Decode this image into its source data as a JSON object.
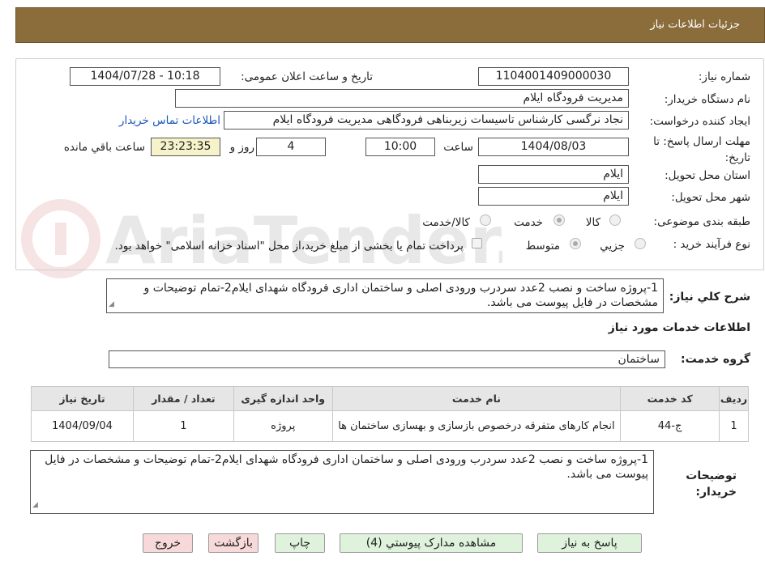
{
  "header": {
    "title": "جزئیات اطلاعات نیاز"
  },
  "form": {
    "need_number_label": "شماره نیاز:",
    "need_number": "1104001409000030",
    "announce_label": "تاریخ و ساعت اعلان عمومی:",
    "announce_value": "1404/07/28 - 10:18",
    "buyer_org_label": "نام دستگاه خریدار:",
    "buyer_org": "مدیریت فرودگاه ایلام",
    "requester_label": "ایجاد کننده درخواست:",
    "requester": "نجاد نرگسی کارشناس تاسیسات زیربناهی فرودگاهی مدیریت فرودگاه ایلام",
    "contact_link": "اطلاعات تماس خریدار",
    "deadline_label": "مهلت ارسال پاسخ: تا تاریخ:",
    "deadline_date": "1404/08/03",
    "time_label": "ساعت",
    "deadline_time": "10:00",
    "days_value": "4",
    "days_label": "روز و",
    "remaining_time": "23:23:35",
    "remaining_label": "ساعت باقي مانده",
    "province_label": "استان محل تحویل:",
    "province": "ایلام",
    "city_label": "شهر محل تحویل:",
    "city": "ایلام",
    "category_label": "طبقه بندی موضوعی:",
    "category_options": [
      "کالا",
      "خدمت",
      "کالا/خدمت"
    ],
    "category_selected": "خدمت",
    "process_label": "نوع فرآیند خرید :",
    "process_options": [
      "جزیي",
      "متوسط"
    ],
    "process_selected": "متوسط",
    "payment_note": "پرداخت تمام یا بخشی از مبلغ خرید،از محل \"اسناد خزانه اسلامی\" خواهد بود."
  },
  "summary": {
    "label": "شرح كلي نياز:",
    "text": "1-پروژه ساخت و نصب 2عدد سردرب ورودی اصلی و ساختمان اداری فرودگاه شهدای ایلام2-تمام توضیحات و مشخصات در فایل پیوست می باشد."
  },
  "services": {
    "title": "اطلاعات خدمات مورد نياز",
    "group_label": "گروه خدمت:",
    "group": "ساختمان",
    "columns": [
      "رديف",
      "کد خدمت",
      "نام خدمت",
      "واحد اندازه گیری",
      "تعداد / مقدار",
      "تاریخ نیاز"
    ],
    "rows": [
      {
        "row": "1",
        "code": "ج-44",
        "name": "انجام کارهای متفرقه درخصوص بازسازی و بهسازی ساختمان ها",
        "unit": "پروژه",
        "qty": "1",
        "date": "1404/09/04"
      }
    ]
  },
  "buyer_notes": {
    "label": "توضيحات خريدار:",
    "text": "1-پروژه ساخت و نصب 2عدد سردرب ورودی اصلی و ساختمان اداری فرودگاه شهدای ایلام2-تمام توضیحات و مشخصات در فایل پیوست می باشد."
  },
  "buttons": {
    "reply": "پاسخ به نياز",
    "attachments": "مشاهده مدارک پیوستي (4)",
    "print": "چاپ",
    "back": "بازگشت",
    "exit": "خروج"
  },
  "watermark": {
    "text": "AriaTender.neT"
  },
  "colors": {
    "header_bg": "#8b6c3b",
    "link": "#1a57b8",
    "time_bg": "#f6f2c9",
    "green_btn": "#def2dc",
    "pink_btn": "#f8d9d9"
  }
}
